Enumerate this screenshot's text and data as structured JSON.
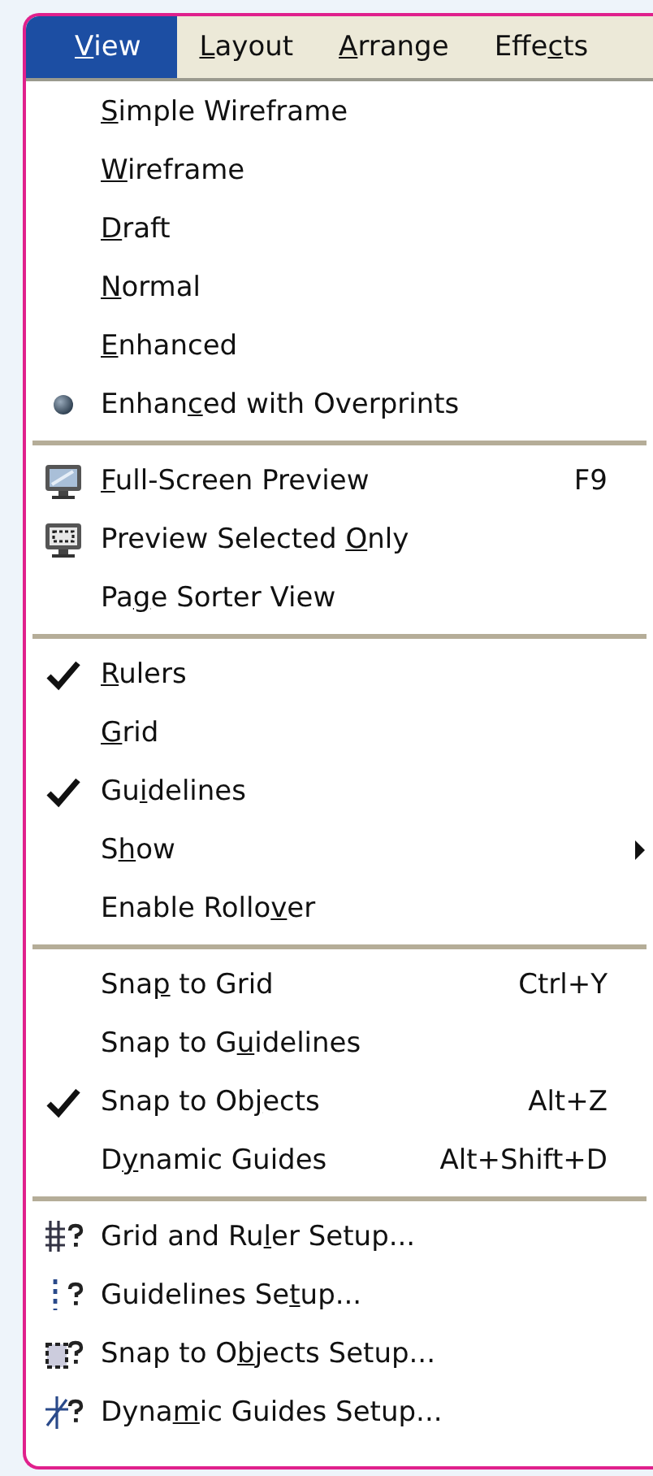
{
  "menu_bar": [
    {
      "key": "V",
      "post": "iew",
      "selected": true
    },
    {
      "key": "L",
      "post": "ayout",
      "selected": false
    },
    {
      "key": "A",
      "post": "rrange",
      "selected": false
    },
    {
      "pre": "Effe",
      "key": "c",
      "post": "ts",
      "selected": false
    }
  ],
  "menu_groups": [
    {
      "items": [
        {
          "kind": "radio",
          "checked": false,
          "key": "S",
          "post": "imple Wireframe",
          "submenu": false
        },
        {
          "kind": "radio",
          "checked": false,
          "key": "W",
          "post": "ireframe",
          "submenu": false
        },
        {
          "kind": "radio",
          "checked": false,
          "key": "D",
          "post": "raft",
          "submenu": false
        },
        {
          "kind": "radio",
          "checked": false,
          "key": "N",
          "post": "ormal",
          "submenu": false
        },
        {
          "kind": "radio",
          "checked": false,
          "key": "E",
          "post": "nhanced",
          "submenu": false
        },
        {
          "kind": "radio",
          "checked": true,
          "pre": "Enhan",
          "key": "c",
          "post": "ed with Overprints",
          "submenu": false
        }
      ]
    },
    {
      "items": [
        {
          "kind": "icon",
          "checked": false,
          "key": "F",
          "post": "ull-Screen Preview",
          "shortcut": "F9",
          "submenu": false
        },
        {
          "kind": "icon",
          "checked": false,
          "pre": "Preview Selected ",
          "key": "O",
          "post": "nly",
          "submenu": false
        },
        {
          "kind": "check",
          "checked": false,
          "pre": "Pa",
          "key": "g",
          "post": "e Sorter View",
          "submenu": false
        }
      ]
    },
    {
      "items": [
        {
          "kind": "check",
          "checked": true,
          "key": "R",
          "post": "ulers",
          "submenu": false
        },
        {
          "kind": "check",
          "checked": false,
          "key": "G",
          "post": "rid",
          "submenu": false
        },
        {
          "kind": "check",
          "checked": true,
          "pre": "Gu",
          "key": "i",
          "post": "delines",
          "submenu": false
        },
        {
          "kind": "check",
          "checked": false,
          "pre": "S",
          "key": "h",
          "post": "ow",
          "submenu": true
        },
        {
          "kind": "check",
          "checked": false,
          "pre": "Enable Rollo",
          "key": "v",
          "post": "er",
          "submenu": false
        }
      ]
    },
    {
      "items": [
        {
          "kind": "check",
          "checked": false,
          "pre": "Sna",
          "key": "p",
          "post": " to Grid",
          "shortcut": "Ctrl+Y",
          "submenu": false
        },
        {
          "kind": "check",
          "checked": false,
          "pre": "Snap to G",
          "key": "u",
          "post": "idelines",
          "submenu": false
        },
        {
          "kind": "check",
          "checked": true,
          "pre": "Snap to Ob",
          "key": "j",
          "post": "ects",
          "shortcut": "Alt+Z",
          "submenu": false
        },
        {
          "kind": "check",
          "checked": false,
          "pre": "D",
          "key": "y",
          "post": "namic Guides",
          "shortcut": "Alt+Shift+D",
          "submenu": false
        }
      ]
    },
    {
      "items": [
        {
          "kind": "icon",
          "checked": false,
          "pre": "Grid and Ru",
          "key": "l",
          "post": "er Setup...",
          "submenu": false
        },
        {
          "kind": "icon",
          "checked": false,
          "pre": "Guidelines Se",
          "key": "t",
          "post": "up...",
          "submenu": false
        },
        {
          "kind": "icon",
          "checked": false,
          "pre": "Snap to O",
          "key": "b",
          "post": "jects Setup...",
          "submenu": false
        },
        {
          "kind": "icon",
          "checked": false,
          "pre": "Dyna",
          "key": "m",
          "post": "ic Guides Setup...",
          "submenu": false
        }
      ]
    }
  ]
}
